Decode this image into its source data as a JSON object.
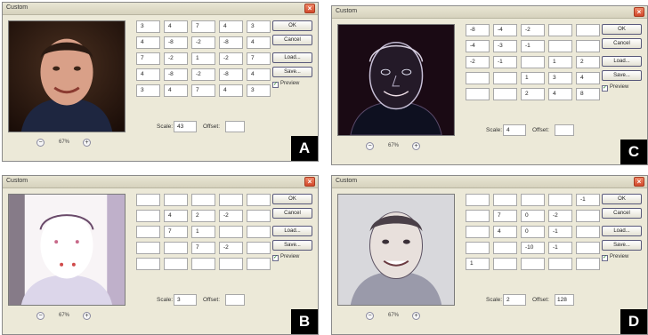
{
  "dialogs": [
    {
      "id": "A",
      "title": "Custom",
      "close_label": "×",
      "tag": "A",
      "zoom": "67%",
      "matrix": [
        "3",
        "4",
        "7",
        "4",
        "3",
        "4",
        "-8",
        "-2",
        "-8",
        "4",
        "7",
        "-2",
        "1",
        "-2",
        "7",
        "4",
        "-8",
        "-2",
        "-8",
        "4",
        "3",
        "4",
        "7",
        "4",
        "3"
      ],
      "scale": "43",
      "offset": "",
      "buttons": {
        "ok": "OK",
        "cancel": "Cancel",
        "load": "Load...",
        "save": "Save..."
      },
      "preview_label": "Preview",
      "preview_checked": true
    },
    {
      "id": "C",
      "title": "Custom",
      "close_label": "×",
      "tag": "C",
      "zoom": "67%",
      "matrix": [
        "-8",
        "-4",
        "-2",
        "",
        "",
        "-4",
        "-3",
        "-1",
        "",
        "",
        "-2",
        "-1",
        "",
        "1",
        "2",
        "",
        "",
        "1",
        "3",
        "4",
        "",
        "",
        "2",
        "4",
        "8"
      ],
      "scale": "4",
      "offset": "",
      "buttons": {
        "ok": "OK",
        "cancel": "Cancel",
        "load": "Load...",
        "save": "Save..."
      },
      "preview_label": "Preview",
      "preview_checked": true
    },
    {
      "id": "B",
      "title": "Custom",
      "close_label": "×",
      "tag": "B",
      "zoom": "67%",
      "matrix": [
        "",
        "",
        "",
        "",
        "",
        "",
        "4",
        "2",
        "-2",
        "",
        "",
        "7",
        "1",
        "",
        "",
        "",
        "",
        "7",
        "-2",
        "",
        "",
        "",
        "",
        "",
        ""
      ],
      "scale": "3",
      "offset": "",
      "buttons": {
        "ok": "OK",
        "cancel": "Cancel",
        "load": "Load...",
        "save": "Save..."
      },
      "preview_label": "Preview",
      "preview_checked": true
    },
    {
      "id": "D",
      "title": "Custom",
      "close_label": "×",
      "tag": "D",
      "zoom": "67%",
      "matrix": [
        "",
        "",
        "",
        "",
        "-1",
        "",
        "7",
        "0",
        "-2",
        "",
        "",
        "4",
        "0",
        "-1",
        "",
        "",
        "",
        "-10",
        "-1",
        "",
        "1",
        "",
        "",
        "",
        ""
      ],
      "scale": "2",
      "offset": "128",
      "buttons": {
        "ok": "OK",
        "cancel": "Cancel",
        "load": "Load...",
        "save": "Save..."
      },
      "preview_label": "Preview",
      "preview_checked": true
    }
  ]
}
